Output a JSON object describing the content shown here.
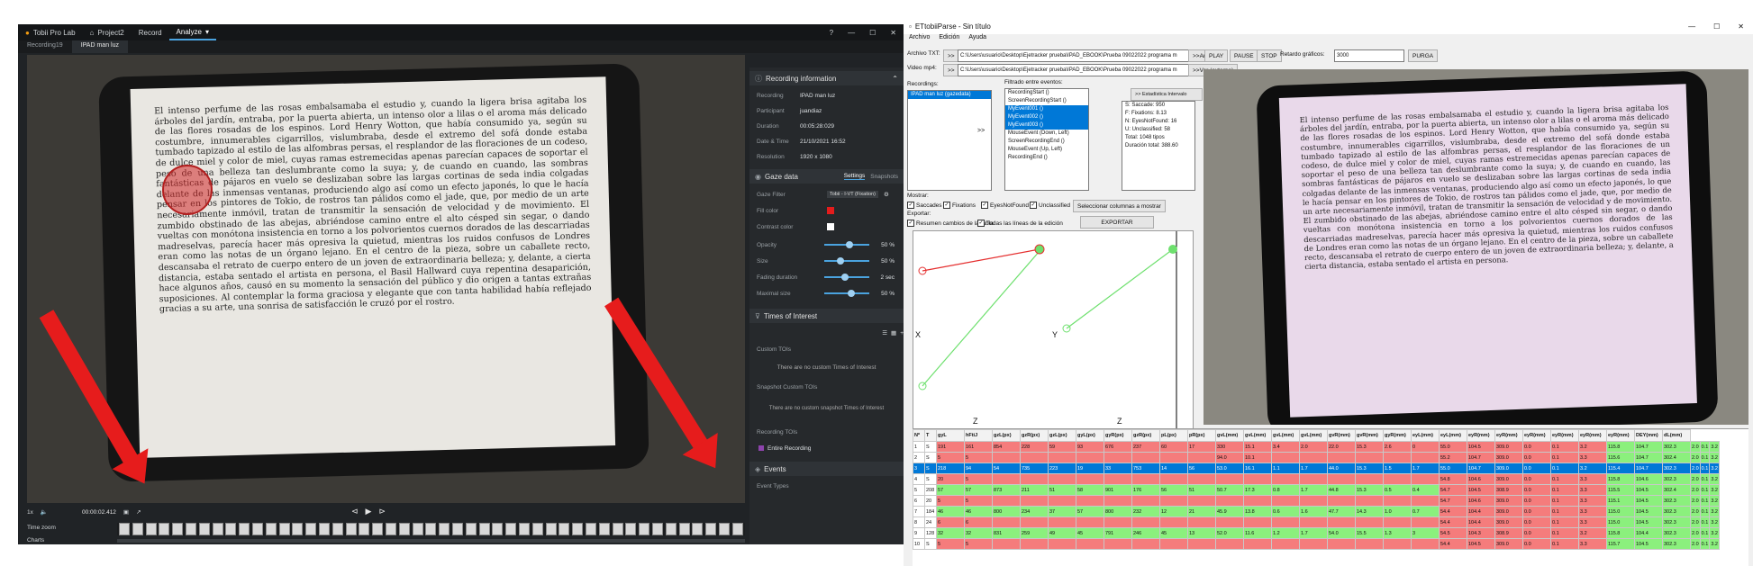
{
  "tobii": {
    "app_name": "Tobii Pro Lab",
    "title_tabs": [
      "Project2",
      "Record",
      "Analyze"
    ],
    "active_title_tab": "Analyze",
    "doc_tabs": [
      "Recording19",
      "IPAD man luz"
    ],
    "video_text": "El intenso perfume de las rosas embalsamaba el estudio y, cuando la ligera brisa agitaba los árboles del jardín, entraba, por la puerta abierta, un intenso olor a lilas o el aroma más delicado de las flores rosadas de los espinos. Lord Henry Wotton, que había consumido ya, según su costumbre, innumerables cigarrillos, vislumbraba, desde el extremo del sofá donde estaba tumbado tapizado al estilo de las alfombras persas, el resplandor de las floraciones de un codeso, de dulce miel y color de miel, cuyas ramas estremecidas apenas parecían capaces de soportar el peso de una belleza tan deslumbrante como la suya; y, de cuando en cuando, las sombras fantásticas de pájaros en vuelo se deslizaban sobre las largas cortinas de seda india colgadas delante de las inmensas ventanas, produciendo algo así como un efecto japonés, lo que le hacía pensar en los pintores de Tokio, de rostros tan pálidos como el jade, que, por medio de un arte necesariamente inmóvil, tratan de transmitir la sensación de velocidad y de movimiento. El zumbido obstinado de las abejas, abriéndose camino entre el alto césped sin segar, o dando vueltas con monótona insistencia en torno a los polvorientos cuernos dorados de las descarriadas madreselvas, parecía hacer más opresiva la quietud, mientras los ruidos confusos de Londres eran como las notas de un órgano lejano. En el centro de la pieza, sobre un caballete recto, descansaba el retrato de cuerpo entero de un joven de extraordinaria belleza; y, delante, a cierta distancia, estaba sentado el artista en persona, el Basil Hallward cuya repentina desaparición, hace algunos años, causó en su momento la sensación del público y dio origen a tantas extrañas suposiciones. Al contemplar la forma graciosa y elegante que con tanta habilidad había reflejado gracias a su arte, una sonrisa de satisfacción le cruzó por el rostro.",
    "time_readout": "00:00:02.412",
    "speed": "1x",
    "timezoom_label": "Time zoom",
    "charts_label": "Charts",
    "panel": {
      "recording_info_title": "Recording information",
      "info": [
        {
          "k": "Recording",
          "v": "IPAD man luz"
        },
        {
          "k": "Participant",
          "v": "juandiaz"
        },
        {
          "k": "Duration",
          "v": "00:05:28:029"
        },
        {
          "k": "Date & Time",
          "v": "21/10/2021 16:52"
        },
        {
          "k": "Resolution",
          "v": "1920 x 1080"
        }
      ],
      "gaze_title": "Gaze data",
      "gaze_tabs": [
        "Settings",
        "Snapshots"
      ],
      "gaze_filter_label": "Gaze Filter",
      "gaze_filter_value": "Tobii - I-VT (Fixation)",
      "fill_color_label": "Fill color",
      "contrast_label": "Contrast color",
      "sliders": [
        {
          "k": "Opacity",
          "v": "50 %",
          "frac": 0.55
        },
        {
          "k": "Size",
          "v": "50 %",
          "frac": 0.35
        },
        {
          "k": "Fading duration",
          "v": "2 sec",
          "frac": 0.45
        },
        {
          "k": "Maximal size",
          "v": "50 %",
          "frac": 0.6
        }
      ],
      "toi_title": "Times of Interest",
      "custom_tois": "Custom TOIs",
      "no_custom": "There are no custom Times of Interest",
      "snapshot_tois": "Snapshot Custom TOIs",
      "no_snapshot": "There are no custom snapshot Times of Interest",
      "recording_tois": "Recording TOIs",
      "entire_recording": "Entire Recording",
      "events_title": "Events",
      "event_types": "Event Types"
    }
  },
  "etp": {
    "window_title": "ETtobiiParse - Sin título",
    "menu": [
      "Archivo",
      "Edición",
      "Ayuda"
    ],
    "archivo_label": "Archivo TXT:",
    "archivo_path": "C:\\Users\\usuario\\Desktop\\Ejetracker prueba\\IPAD_EBOOK\\Prueba 09022022 programa m",
    "analizar_btn": ">>Analizar",
    "video_label": "Video mp4:",
    "video_path": "C:\\Users\\usuario\\Desktop\\Ejetracker prueba\\IPAD_EBOOK\\Prueba 09022022 programa m",
    "ver_btn": ">>Ver (externo)",
    "play_btn": "PLAY",
    "pause_btn": "PAUSE",
    "stop_btn": "STOP",
    "retardo_label": "Retardo gráficos:",
    "retardo_value": "3000",
    "purga_btn": "PURGA",
    "recordings_label": "Recordings:",
    "recordings": [
      "IPAD man luz (gazedata)"
    ],
    "events_label": "Filtrado entre eventos:",
    "events": [
      "RecordingStart ()",
      "ScreenRecordingStart ()",
      "MyEvent001 ()",
      "MyEvent002 ()",
      "MyEvent003 ()",
      "MouseEvent (Down, Left)",
      "ScreenRecordingEnd ()",
      "MouseEvent (Up, Left)",
      "RecordingEnd ()"
    ],
    "selected_events": [
      2,
      3,
      4
    ],
    "arrow_gt": ">>",
    "stats_btn": ">> Estadística Intervalo",
    "stats": [
      "S: Saccade: 950",
      "F: Fixations: 8.13",
      "N: EyesNotFound: 16",
      "U: Unclassified: 58",
      "Total: 1048 tipos",
      "Duración total: 388.60"
    ],
    "mostrar_label": "Mostrar:",
    "checks": [
      "Saccades",
      "Fixations",
      "EyesNotFound",
      "Unclassified"
    ],
    "select_cols_btn": "Seleccionar columnas a mostrar",
    "exportar_label": "Exportar:",
    "export_checks": [
      "Resumen cambios de la tabla",
      "Todas las líneas de la edición"
    ],
    "exportar_btn": "EXPORTAR",
    "plot_labels": {
      "x": "X",
      "y": "Y",
      "z1": "Z",
      "z2": "Z"
    },
    "video_text": "El intenso perfume de las rosas embalsamaba el estudio y, cuando la ligera brisa agitaba los árboles del jardín, entraba, por la puerta abierta, un intenso olor a lilas o el aroma más delicado de las flores rosadas de los espinos. Lord Henry Wotton, que había consumido ya, según su costumbre, innumerables cigarrillos, vislumbraba, desde el extremo del sofá donde estaba tumbado tapizado al estilo de las alfombras persas, el resplandor de las floraciones de un codeso, de dulce miel y color de miel, cuyas ramas estremecidas apenas parecían capaces de soportar el peso de una belleza tan deslumbrante como la suya; y, de cuando en cuando, las sombras fantásticas de pájaros en vuelo se deslizaban sobre las largas cortinas de seda india colgadas delante de las inmensas ventanas, produciendo algo así como un efecto japonés, lo que le hacía pensar en los pintores de Tokio, de rostros tan pálidos como el jade, que, por medio de un arte necesariamente inmóvil, tratan de transmitir la sensación de velocidad y de movimiento. El zumbido obstinado de las abejas, abriéndose camino entre el alto césped sin segar, o dando vueltas con monótona insistencia en torno a los polvorientos cuernos dorados de las descarriadas madreselvas, parecía hacer más opresiva la quietud, mientras los ruidos confusos de Londres eran como las notas de un órgano lejano. En el centro de la pieza, sobre un caballete recto, descansaba el retrato de cuerpo entero de un joven de extraordinaria belleza; y, delante, a cierta distancia, estaba sentado el artista en persona.",
    "table_headers": [
      "Nº",
      "T",
      "gyL",
      "hFtiJ",
      "gzL(px)",
      "gzR(px)",
      "gzL(px)",
      "gyL(px)",
      "gyR(px)",
      "gzR(px)",
      "pL(px)",
      "pR(px)",
      "gvL(mm)",
      "gvL(mm)",
      "gvL(mm)",
      "gvL(mm)",
      "gvR(mm)",
      "gvR(mm)",
      "gyR(mm)",
      "eyL(mm)",
      "eyL(mm)",
      "eyR(mm)",
      "eyR(mm)",
      "eyR(mm)",
      "eyR(mm)",
      "eyR(mm)",
      "eyR(mm)",
      "DEY(mm)",
      "dL(mm)"
    ],
    "table_rows": [
      {
        "c": "red",
        "v": [
          "1",
          "S",
          "191",
          "161",
          "854",
          "228",
          "59",
          "93",
          "676",
          "237",
          "60",
          "17",
          "330",
          "15.1",
          "3.4",
          "2.0",
          "22.0",
          "15.3",
          "2.6",
          "0",
          "55.0",
          "104.5",
          "309.0",
          "0.0",
          "0.1",
          "3.2",
          "115.8",
          "104.7",
          "302.3",
          "2.0",
          "0.1",
          "3.2"
        ]
      },
      {
        "c": "red",
        "v": [
          "2",
          "S",
          "5",
          "5",
          "",
          "",
          "",
          "",
          "",
          "",
          "",
          "",
          "94.0",
          "10.1",
          "",
          "",
          "",
          "",
          "",
          "",
          "55.2",
          "104.7",
          "309.0",
          "0.0",
          "0.1",
          "3.3",
          "115.6",
          "104.7",
          "302.4",
          "2.0",
          "0.1",
          "3.2"
        ]
      },
      {
        "c": "sel",
        "v": [
          "3",
          "S",
          "218",
          "94",
          "54",
          "735",
          "223",
          "19",
          "33",
          "753",
          "14",
          "56",
          "53.0",
          "16.1",
          "1.1",
          "1.7",
          "44.0",
          "15.3",
          "1.5",
          "1.7",
          "55.0",
          "104.7",
          "309.0",
          "0.0",
          "0.1",
          "3.2",
          "115.4",
          "104.7",
          "302.3",
          "2.0",
          "0.1",
          "3.2"
        ]
      },
      {
        "c": "red",
        "v": [
          "4",
          "S",
          "20",
          "5",
          "",
          "",
          "",
          "",
          "",
          "",
          "",
          "",
          "",
          "",
          "",
          "",
          "",
          "",
          "",
          "",
          "54.8",
          "104.6",
          "309.0",
          "0.0",
          "0.1",
          "3.3",
          "115.8",
          "104.6",
          "302.3",
          "2.0",
          "0.1",
          "3.2"
        ]
      },
      {
        "c": "grn",
        "v": [
          "5",
          "208",
          "57",
          "57",
          "873",
          "211",
          "51",
          "58",
          "901",
          "176",
          "56",
          "51",
          "50.7",
          "17.3",
          "0.8",
          "1.7",
          "44.8",
          "15.3",
          "0.5",
          "0.4",
          "54.7",
          "104.5",
          "308.9",
          "0.0",
          "0.1",
          "3.3",
          "115.5",
          "104.5",
          "302.4",
          "2.0",
          "0.1",
          "3.2"
        ]
      },
      {
        "c": "red",
        "v": [
          "6",
          "20",
          "5",
          "5",
          "",
          "",
          "",
          "",
          "",
          "",
          "",
          "",
          "",
          "",
          "",
          "",
          "",
          "",
          "",
          "",
          "54.7",
          "104.6",
          "309.0",
          "0.0",
          "0.1",
          "3.3",
          "115.1",
          "104.5",
          "302.3",
          "2.0",
          "0.1",
          "3.2"
        ]
      },
      {
        "c": "grn",
        "v": [
          "7",
          "184",
          "46",
          "46",
          "800",
          "234",
          "37",
          "57",
          "800",
          "232",
          "12",
          "21",
          "45.9",
          "13.8",
          "0.6",
          "1.6",
          "47.7",
          "14.3",
          "1.0",
          "0.7",
          "54.4",
          "104.4",
          "309.0",
          "0.0",
          "0.1",
          "3.3",
          "115.0",
          "104.5",
          "302.3",
          "2.0",
          "0.1",
          "3.2"
        ]
      },
      {
        "c": "red",
        "v": [
          "8",
          "24",
          "6",
          "6",
          "",
          "",
          "",
          "",
          "",
          "",
          "",
          "",
          "",
          "",
          "",
          "",
          "",
          "",
          "",
          "",
          "54.4",
          "104.4",
          "309.0",
          "0.0",
          "0.1",
          "3.3",
          "115.0",
          "104.5",
          "302.3",
          "2.0",
          "0.1",
          "3.2"
        ]
      },
      {
        "c": "grn",
        "v": [
          "9",
          "128",
          "32",
          "32",
          "831",
          "259",
          "49",
          "45",
          "791",
          "246",
          "45",
          "13",
          "52.0",
          "11.6",
          "1.2",
          "1.7",
          "54.0",
          "15.5",
          "1.3",
          "3",
          "54.5",
          "104.3",
          "308.9",
          "0.0",
          "0.1",
          "3.2",
          "115.8",
          "104.4",
          "302.3",
          "2.0",
          "0.1",
          "3.2"
        ]
      },
      {
        "c": "red",
        "v": [
          "10",
          "S",
          "5",
          "5",
          "",
          "",
          "",
          "",
          "",
          "",
          "",
          "",
          "",
          "",
          "",
          "",
          "",
          "",
          "",
          "",
          "54.4",
          "104.5",
          "309.0",
          "0.0",
          "0.1",
          "3.3",
          "115.7",
          "104.5",
          "302.3",
          "2.0",
          "0.1",
          "3.2"
        ]
      }
    ]
  },
  "colors": {
    "red_arrow": "#e61c1c",
    "accent": "#4aa3df",
    "row_red": "#f57c7c",
    "row_green": "#8bf07d",
    "selection": "#0078d7"
  },
  "icons": [
    "tobii-logo-icon",
    "home-icon",
    "help-icon",
    "minimize-icon",
    "maximize-icon",
    "close-icon",
    "play-icon",
    "skip-back-icon",
    "skip-forward-icon",
    "volume-icon",
    "camera-icon",
    "share-icon",
    "gear-icon",
    "chevron-up-icon",
    "filter-icon",
    "list-view-icon",
    "add-icon"
  ]
}
